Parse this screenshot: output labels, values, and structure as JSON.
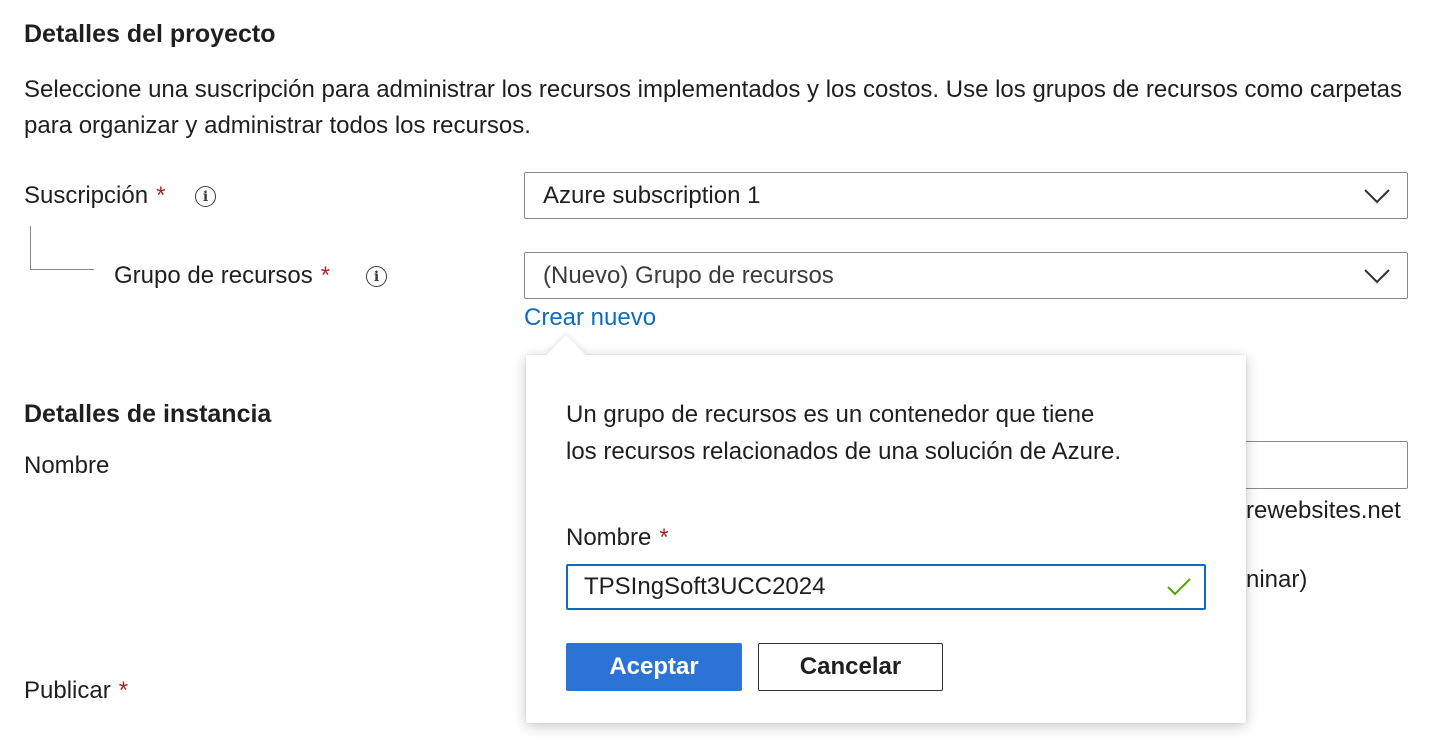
{
  "project": {
    "title": "Detalles del proyecto",
    "description": "Seleccione una suscripción para administrar los recursos implementados y los costos. Use los grupos de recursos como carpetas para organizar y administrar todos los recursos.",
    "subscription": {
      "label": "Suscripción",
      "required_marker": "*",
      "value": "Azure subscription 1"
    },
    "resource_group": {
      "label": "Grupo de recursos",
      "required_marker": "*",
      "value": "(Nuevo) Grupo de recursos",
      "create_new_link": "Crear nuevo"
    }
  },
  "instance": {
    "title": "Detalles de instancia",
    "name_label": "Nombre",
    "domain_suffix_partial": "rewebsites.net",
    "partial_text": "ninar)",
    "publish_label": "Publicar",
    "publish_required_marker": "*"
  },
  "popup": {
    "description_line1": "Un grupo de recursos es un contenedor que tiene",
    "description_line2": "los recursos relacionados de una solución de Azure.",
    "name_label": "Nombre",
    "name_required_marker": "*",
    "name_value": "TPSIngSoft3UCC2024",
    "accept_label": "Aceptar",
    "cancel_label": "Cancelar"
  },
  "colors": {
    "required": "#a4262c",
    "link": "#0f6cbd",
    "primary_button": "#2b74d6",
    "valid_check": "#57a300"
  },
  "icons": {
    "info": "info-icon",
    "dropdown": "chevron-down-icon",
    "valid": "checkmark-icon"
  }
}
